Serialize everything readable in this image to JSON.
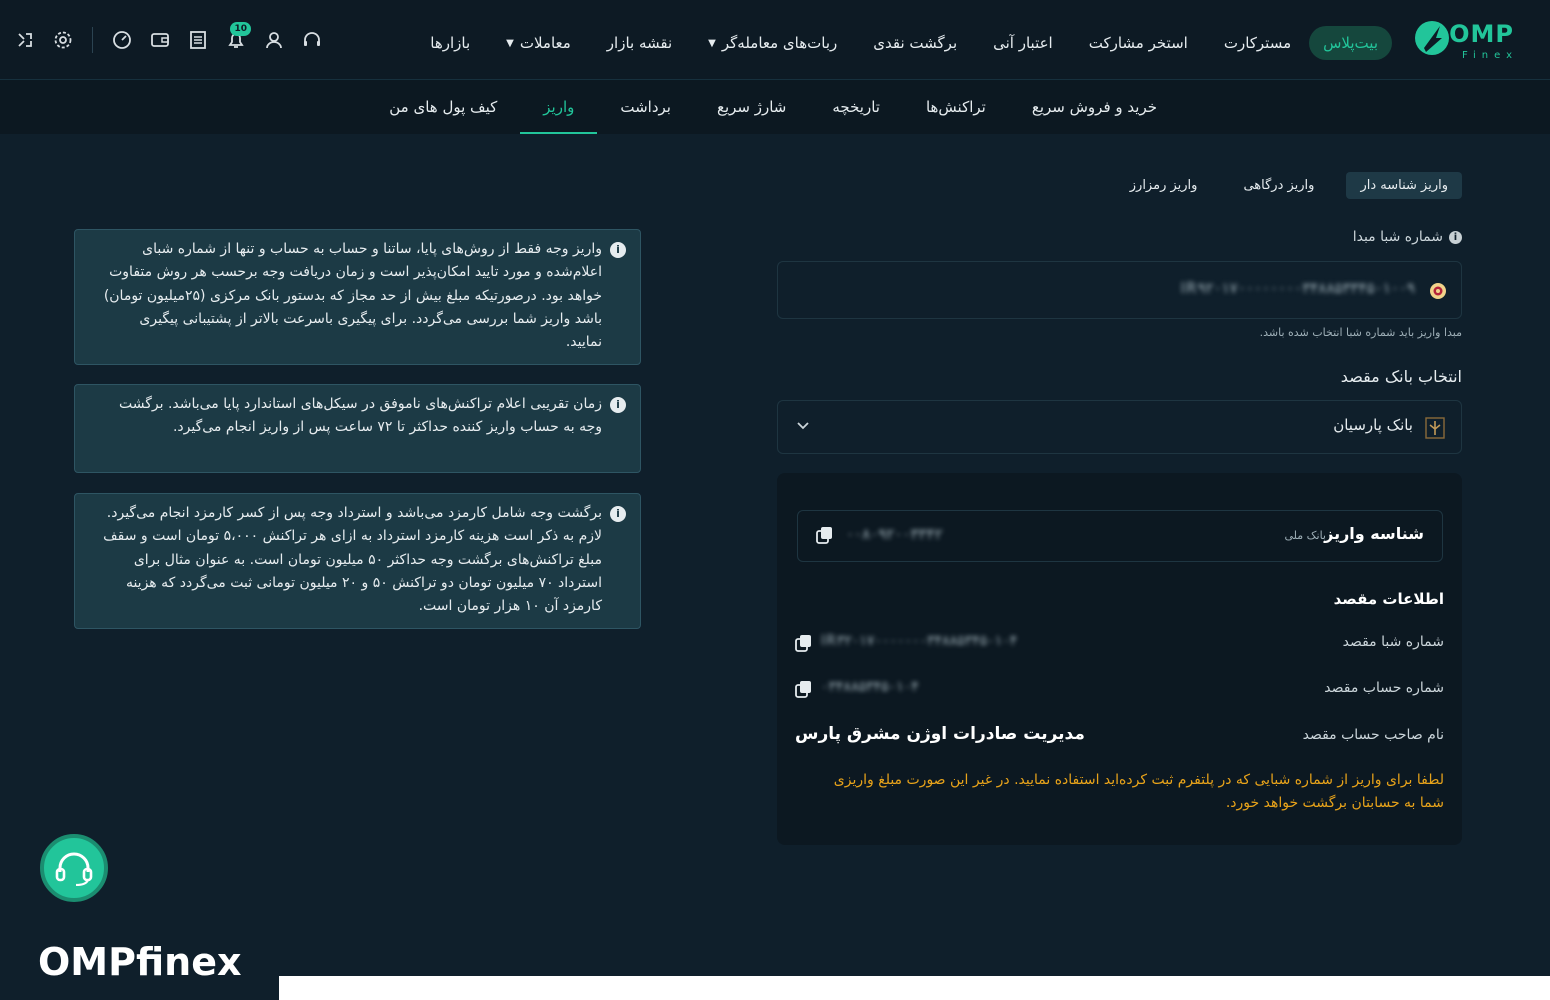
{
  "brand": {
    "logo_text": "OMP",
    "logo_sub": "Finex",
    "watermark": "OMPfinex",
    "accent": "#22c59a"
  },
  "main_nav": [
    {
      "label": "بازارها",
      "caret": false
    },
    {
      "label": "معاملات",
      "caret": true
    },
    {
      "label": "نقشه بازار",
      "caret": false
    },
    {
      "label": "ربات‌های معامله‌گر",
      "caret": true
    },
    {
      "label": "برگشت نقدی",
      "caret": false
    },
    {
      "label": "اعتبار آنی",
      "caret": false
    },
    {
      "label": "استخر مشارکت",
      "caret": false
    },
    {
      "label": "مسترکارت",
      "caret": false
    },
    {
      "label": "بیت‌پلاس",
      "caret": false
    }
  ],
  "header_icons": {
    "notification_badge": "10"
  },
  "sub_tabs": [
    {
      "label": "کیف پول های من",
      "active": false
    },
    {
      "label": "واریز",
      "active": true
    },
    {
      "label": "برداشت",
      "active": false
    },
    {
      "label": "شارژ سریع",
      "active": false
    },
    {
      "label": "تاریخچه",
      "active": false
    },
    {
      "label": "تراکنش‌ها",
      "active": false
    },
    {
      "label": "خرید و فروش سریع",
      "active": false
    }
  ],
  "deposit_methods": [
    {
      "label": "واریز رمزارز",
      "active": false
    },
    {
      "label": "واریز درگاهی",
      "active": false
    },
    {
      "label": "واریز شناسه دار",
      "active": true
    }
  ],
  "form": {
    "source_sheba_label": "شماره شبا مبدا",
    "source_sheba_value": "IR۹۲۰۱۷۰۰۰۰۰۰۰۰۳۴۸۸۵۳۳۴۵۰۱۰۰۹",
    "source_hint": "مبدا واریز باید شماره شبا انتخاب شده باشد.",
    "dest_bank_label": "انتخاب بانک مقصد",
    "dest_bank_value": "بانک پارسیان"
  },
  "deposit_card": {
    "id_label": "شناسه واریز",
    "id_sub": "بانک ملی",
    "id_value": "۰۰۸۰۹۲۰۰۳۳۴۲",
    "dest_info_title": "اطلاعات مقصد",
    "dest_sheba_label": "شماره شبا مقصد",
    "dest_sheba_value": "IR۳۲۰۱۷۰۰۰۰۰۰۰۳۴۸۸۵۳۴۵۰۱۰۴",
    "dest_account_label": "شماره حساب مقصد",
    "dest_account_value": "۰۳۴۸۸۵۳۴۵۰۱۰۴",
    "dest_owner_label": "نام صاحب حساب مقصد",
    "dest_owner_value": "مدیریت صادرات اوژن مشرق پارس",
    "warning": "لطفا برای واریز از شماره شبایی که در پلتفرم ثبت کرده‌اید استفاده نمایید. در غیر این صورت مبلغ واریزی شما به حسابتان برگشت خواهد خورد."
  },
  "notices": [
    "واریز وجه فقط از روش‌های پایا، ساتنا و حساب به حساب و تنها از شماره شبای اعلام‌شده و مورد تایید امکان‌پذیر است و زمان دریافت وجه برحسب هر روش متفاوت خواهد بود. درصورتیکه مبلغ بیش از حد مجاز که بدستور بانک مرکزی (۲۵میلیون تومان) باشد واریز شما بررسی می‌گردد. برای پیگیری باسرعت بالاتر از پشتیبانی پیگیری نمایید.",
    "زمان تقریبی اعلام تراکنش‌های ناموفق در سیکل‌های استاندارد پایا می‌باشد. برگشت وجه به حساب واریز کننده حداکثر تا ۷۲ ساعت پس از واریز انجام می‌گیرد.",
    "برگشت وجه شامل کارمزد می‌باشد و استرداد وجه پس از کسر کارمزد انجام می‌گیرد. لازم به ذکر است هزینه کارمزد استرداد به ازای هر تراکنش ۵،۰۰۰ تومان است و سقف مبلغ تراکنش‌های برگشت وجه حداکثر ۵۰ میلیون تومان است. به عنوان مثال برای استرداد ۷۰ میلیون تومان دو تراکنش ۵۰ و ۲۰ میلیون تومانی ثبت می‌گردد که هزینه کارمزد آن ۱۰ هزار تومان است."
  ]
}
